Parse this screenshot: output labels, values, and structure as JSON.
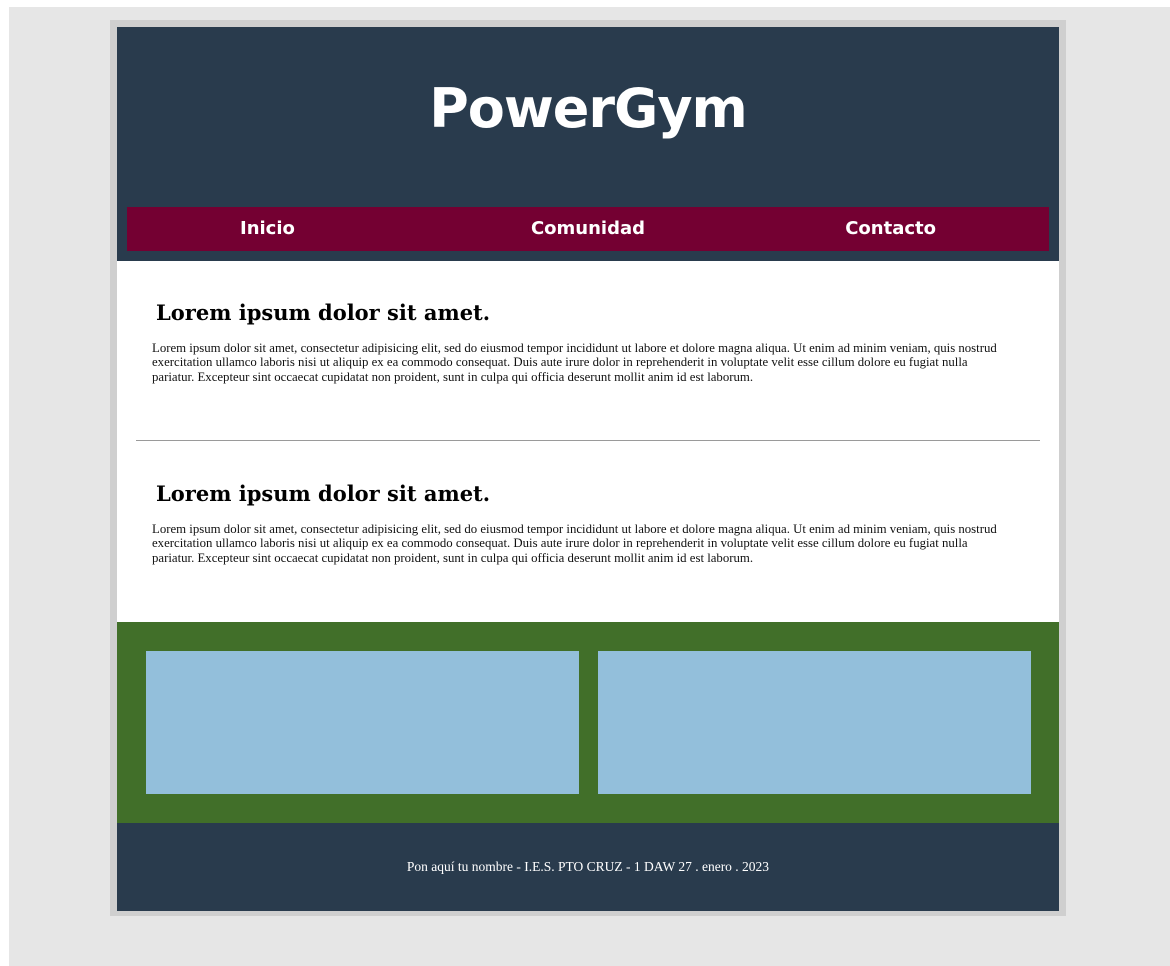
{
  "header": {
    "logo_text": "PowerGym"
  },
  "nav": {
    "items": [
      {
        "label": "Inicio"
      },
      {
        "label": "Comunidad"
      },
      {
        "label": "Contacto"
      }
    ]
  },
  "articles": [
    {
      "title": "Lorem ipsum dolor sit amet.",
      "body": "Lorem ipsum dolor sit amet, consectetur adipisicing elit, sed do eiusmod tempor incididunt ut labore et dolore magna aliqua. Ut enim ad minim veniam, quis nostrud exercitation ullamco laboris nisi ut aliquip ex ea commodo consequat. Duis aute irure dolor in reprehenderit in voluptate velit esse cillum dolore eu fugiat nulla pariatur. Excepteur sint occaecat cupidatat non proident, sunt in culpa qui officia deserunt mollit anim id est laborum."
    },
    {
      "title": "Lorem ipsum dolor sit amet.",
      "body": "Lorem ipsum dolor sit amet, consectetur adipisicing elit, sed do eiusmod tempor incididunt ut labore et dolore magna aliqua. Ut enim ad minim veniam, quis nostrud exercitation ullamco laboris nisi ut aliquip ex ea commodo consequat. Duis aute irure dolor in reprehenderit in voluptate velit esse cillum dolore eu fugiat nulla pariatur. Excepteur sint occaecat cupidatat non proident, sunt in culpa qui officia deserunt mollit anim id est laborum."
    }
  ],
  "footer": {
    "text": "Pon aquí tu nombre - I.E.S. PTO CRUZ - 1 DAW 27 . enero . 2023"
  },
  "colors": {
    "header_bg": "#293b4d",
    "nav_bg": "#740032",
    "gallery_bg": "#416f29",
    "box_bg": "#93bfdb",
    "page_bg": "#e6e6e6"
  }
}
